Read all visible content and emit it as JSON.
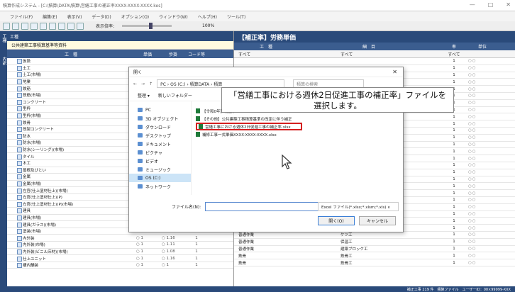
{
  "window": {
    "title": "積算作成システム - [C:\\積算\\DATA\\積算\\営繕工事の補正率XXXX-XXXX-XXXX.kes]",
    "controls": [
      "—",
      "□",
      "✕"
    ]
  },
  "menu": [
    "ファイル(F)",
    "編集(E)",
    "表示(V)",
    "データ(D)",
    "オプション(O)",
    "ウィンドウ(W)",
    "ヘルプ(H)",
    "ツール(T)"
  ],
  "toolbar": {
    "zoom_label": "表示倍率：",
    "zoom_value": "100%"
  },
  "side_strip": [
    "工種",
    "内訳"
  ],
  "left_pane": {
    "header": "工種",
    "subtitle": "公共建築工事積算基準等資料",
    "columns": [
      "工　種",
      "単価",
      "歩掛",
      "コード等"
    ],
    "rows": [
      {
        "name": "仮設"
      },
      {
        "name": "土工"
      },
      {
        "name": "土工(市場)"
      },
      {
        "name": "地業"
      },
      {
        "name": "鉄筋"
      },
      {
        "name": "鉄筋(市場)"
      },
      {
        "name": "コンクリート"
      },
      {
        "name": "型枠"
      },
      {
        "name": "型枠(市場)"
      },
      {
        "name": "鉄骨"
      },
      {
        "name": "既製コンクリート"
      },
      {
        "name": "防水"
      },
      {
        "name": "防水(市場)"
      },
      {
        "name": "防水(シーリング)(市場)"
      },
      {
        "name": "タイル"
      },
      {
        "name": "木工"
      },
      {
        "name": "屋根及びとい"
      },
      {
        "name": "金属"
      },
      {
        "name": "金属(市場)"
      },
      {
        "name": "左官(仕上塗材仕上)(市場)"
      },
      {
        "name": "左官(仕上塗材仕上)(P)"
      },
      {
        "name": "左官(仕上塗材仕上)(P)(市場)"
      },
      {
        "name": "建具"
      },
      {
        "name": "建具(市場)"
      },
      {
        "name": "建具(ガラス)(市場)",
        "c2": "○ 1",
        "c3": "○ 1.14",
        "c4": "1"
      },
      {
        "name": "塗装(市場)",
        "c2": "○ 1",
        "c3": "○ 1.14",
        "c4": "1"
      },
      {
        "name": "内外装",
        "c2": "○ 1",
        "c3": "○ 1.16",
        "c4": "1"
      },
      {
        "name": "内外装(市場)",
        "c2": "○ 1",
        "c3": "○ 1.11",
        "c4": "1"
      },
      {
        "name": "内外装(ビニル床材)(市場)",
        "c2": "○ 1",
        "c3": "○ 1.08",
        "c4": "1"
      },
      {
        "name": "仕上ユニット",
        "c2": "○ 1",
        "c3": "○ 1.16",
        "c4": "1"
      },
      {
        "name": "構内舗装",
        "c2": "○ 1",
        "c3": "○ 1",
        "c4": "1"
      }
    ]
  },
  "right_pane": {
    "title": "【補正率】労務単価",
    "columns": [
      "工　種",
      "細　目",
      "率",
      "単位"
    ],
    "filters": [
      "すべて",
      "すべて",
      "すべて"
    ],
    "rows": [
      {
        "a": "",
        "b": "",
        "q": "1",
        "o": "○○"
      },
      {
        "a": "",
        "b": "",
        "q": "1",
        "o": "○○"
      },
      {
        "a": "",
        "b": "",
        "q": "1",
        "o": "○○"
      },
      {
        "a": "",
        "b": "",
        "q": "1",
        "o": "○○"
      },
      {
        "a": "",
        "b": "",
        "q": "1",
        "o": "○○"
      },
      {
        "a": "",
        "b": "",
        "q": "1",
        "o": "○○"
      },
      {
        "a": "",
        "b": "",
        "q": "1",
        "o": "○○"
      },
      {
        "a": "",
        "b": "",
        "q": "1",
        "o": "○○"
      },
      {
        "a": "",
        "b": "",
        "q": "1",
        "o": "○○"
      },
      {
        "a": "",
        "b": "",
        "q": "1",
        "o": "○○"
      },
      {
        "a": "",
        "b": "",
        "q": "1",
        "o": "○○"
      },
      {
        "a": "",
        "b": "",
        "q": "1",
        "o": "○○"
      },
      {
        "a": "",
        "b": "",
        "q": "1",
        "o": "○○"
      },
      {
        "a": "",
        "b": "",
        "q": "1",
        "o": "○○"
      },
      {
        "a": "",
        "b": "",
        "q": "1",
        "o": "○○"
      },
      {
        "a": "",
        "b": "",
        "q": "1",
        "o": "○○"
      },
      {
        "a": "",
        "b": "",
        "q": "1",
        "o": "○○"
      },
      {
        "a": "",
        "b": "",
        "q": "1",
        "o": "○○"
      },
      {
        "a": "",
        "b": "",
        "q": "1",
        "o": "○○"
      },
      {
        "a": "",
        "b": "",
        "q": "1",
        "o": "○○"
      },
      {
        "a": "",
        "b": "",
        "q": "1",
        "o": "○○"
      },
      {
        "a": "",
        "b": "",
        "q": "1",
        "o": "○○"
      },
      {
        "a": "",
        "b": "",
        "q": "1",
        "o": "○○"
      },
      {
        "a": "普通作業",
        "b": "ガラス工",
        "q": "1",
        "o": "○○"
      },
      {
        "a": "普通作業",
        "b": "塗装工",
        "q": "1",
        "o": "○○"
      },
      {
        "a": "普通作業",
        "b": "ケツ工",
        "q": "1",
        "o": "○○"
      },
      {
        "a": "普通作業",
        "b": "保温工",
        "q": "1",
        "o": "○○"
      },
      {
        "a": "普通作業",
        "b": "建築ブロック工",
        "q": "1",
        "o": "○○"
      },
      {
        "a": "鉄骨",
        "b": "鉄骨工",
        "q": "1",
        "o": "○○"
      },
      {
        "a": "鉄骨",
        "b": "鉄骨工",
        "q": "1",
        "o": "○○"
      }
    ]
  },
  "status": "補正工事 219 件　積算ファイル　ユーザーID：00×99999-XXX",
  "dialog": {
    "title": "開く",
    "close": "✕",
    "path": "PC › OS (C:) › 積算DATA › 積算",
    "search_placeholder": "積算の検索",
    "organize": "整理 ▾",
    "new_folder": "新しいフォルダー",
    "sidebar": [
      "PC",
      "3D オブジェクト",
      "ダウンロード",
      "デスクトップ",
      "ドキュメント",
      "ピクチャ",
      "ビデオ",
      "ミュージック",
      "OS (C:)",
      "ネットワーク"
    ],
    "sidebar_selected": 8,
    "files": [
      "【令和0年】補正率",
      "【その他】公共建築工事積算基準の改定に伴う補正",
      "営繕工事における週休2日促進工事の補正率.xlsx",
      "補修工事一式単価XXXX-XXXX-XXXX.xlsx"
    ],
    "highlight_index": 2,
    "filename_label": "ファイル名(N):",
    "filetype": "Excel ファイル(*.xlsx;*.xlsm;*.xls) ∨",
    "open_label": "開く(O)",
    "cancel_label": "キャンセル"
  },
  "callout": {
    "line1": "「営繕工事における週休2日促進工事の補正率」ファイルを",
    "line2": "選択します。"
  }
}
